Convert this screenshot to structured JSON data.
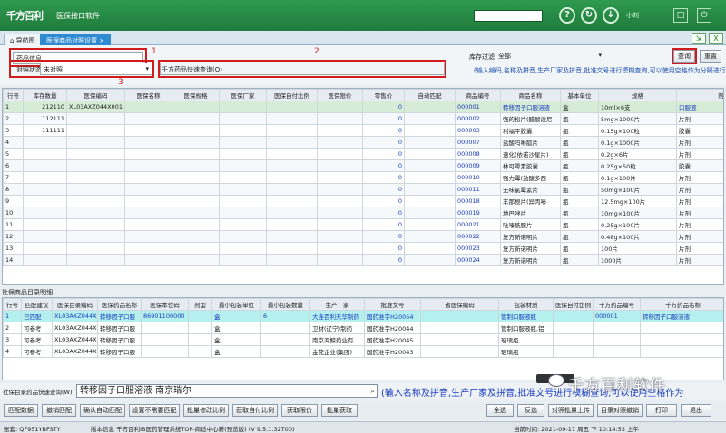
{
  "app": {
    "logo": "千方百利",
    "name": "医保接口软件",
    "user": "小刘"
  },
  "titlebar_icons": [
    "help-icon",
    "refresh-icon",
    "download-icon",
    "maximize-icon",
    "power-icon"
  ],
  "tabs": [
    {
      "label": "导航图"
    },
    {
      "label": "医保商品对照设置"
    }
  ],
  "filter": {
    "drug_input_value": "药品信息",
    "match_status_label": "对照状态",
    "match_status_value": "未对照",
    "quick_query_label": "千方药品快速查询(Q)",
    "stock_filter_label": "库存过滤",
    "stock_filter_value": "全部",
    "query_button": "查询",
    "reset_button": "重置",
    "hint": "(输入编码,名称及拼音,生产厂家及拼音,批准文号进行模糊查询,可以使用空格作为分隔进行",
    "annotations": [
      "1",
      "2",
      "3"
    ]
  },
  "upper_table": {
    "headers": [
      "行号",
      "库存数量",
      "医保编码",
      "医保名称",
      "医保规格",
      "医保厂家",
      "医保自付比例",
      "医保限价",
      "零售价",
      "自动匹配",
      "商品编号",
      "商品名称",
      "基本单位",
      "规格",
      "剂型"
    ],
    "rows": [
      [
        "1",
        "212110",
        "XL03AXZ044X001",
        "",
        "",
        "",
        "",
        "",
        "0",
        "",
        "000001",
        "转移因子口服溶液",
        "盒",
        "10ml×6支",
        "口服液"
      ],
      [
        "2",
        "112111",
        "",
        "",
        "",
        "",
        "",
        "",
        "0",
        "",
        "000002",
        "强的松片(醋酸泼尼",
        "瓶",
        "5mg×1000片",
        "片剂"
      ],
      [
        "3",
        "111111",
        "",
        "",
        "",
        "",
        "",
        "",
        "0",
        "",
        "000003",
        "利福平胶囊",
        "瓶",
        "0.15g×100粒",
        "胶囊"
      ],
      [
        "4",
        "",
        "",
        "",
        "",
        "",
        "",
        "",
        "0",
        "",
        "000007",
        "盐酸吗啉胍片",
        "瓶",
        "0.1g×1000片",
        "片剂"
      ],
      [
        "5",
        "",
        "",
        "",
        "",
        "",
        "",
        "",
        "0",
        "",
        "000008",
        "速化(依诺沙星片)",
        "瓶",
        "0.2g×6片",
        "片剂"
      ],
      [
        "6",
        "",
        "",
        "",
        "",
        "",
        "",
        "",
        "0",
        "",
        "000009",
        "林可霉素胶囊",
        "瓶",
        "0.25g×50粒",
        "胶囊"
      ],
      [
        "7",
        "",
        "",
        "",
        "",
        "",
        "",
        "",
        "0",
        "",
        "000010",
        "强力霉(盐酸多西",
        "瓶",
        "0.1g×100片",
        "片剂"
      ],
      [
        "8",
        "",
        "",
        "",
        "",
        "",
        "",
        "",
        "0",
        "",
        "000011",
        "无味氯霉素片",
        "瓶",
        "50mg×100片",
        "片剂"
      ],
      [
        "9",
        "",
        "",
        "",
        "",
        "",
        "",
        "",
        "0",
        "",
        "000018",
        "丰那根片(异丙嗪",
        "瓶",
        "12.5mg×100片",
        "片剂"
      ],
      [
        "10",
        "",
        "",
        "",
        "",
        "",
        "",
        "",
        "0",
        "",
        "000019",
        "地巴唑片",
        "瓶",
        "10mg×100片",
        "片剂"
      ],
      [
        "11",
        "",
        "",
        "",
        "",
        "",
        "",
        "",
        "0",
        "",
        "000021",
        "吡嗪酰胺片",
        "瓶",
        "0.25g×100片",
        "片剂"
      ],
      [
        "12",
        "",
        "",
        "",
        "",
        "",
        "",
        "",
        "0",
        "",
        "000022",
        "复方新诺明片",
        "瓶",
        "0.48g×100片",
        "片剂"
      ],
      [
        "13",
        "",
        "",
        "",
        "",
        "",
        "",
        "",
        "0",
        "",
        "000023",
        "复方新诺明片",
        "瓶",
        "100片",
        "片剂"
      ],
      [
        "14",
        "",
        "",
        "",
        "",
        "",
        "",
        "",
        "0",
        "",
        "000024",
        "复方新诺明片",
        "瓶",
        "1000片",
        "片剂"
      ]
    ]
  },
  "lower_section_title": "社保商品目录明细",
  "lower_table": {
    "headers": [
      "行号",
      "匹配建议",
      "医保目录编码",
      "医保药品名称",
      "医保本位码",
      "剂型",
      "最小包装单位",
      "最小包装数量",
      "生产厂家",
      "批准文号",
      "省医保编码",
      "包装材质",
      "医保自付比例",
      "千方药品编号",
      "千方药品名称"
    ],
    "rows": [
      [
        "1",
        "已匹配",
        "XL03AXZ044X00",
        "转移因子口服",
        "86901100000",
        "",
        "盒",
        "6",
        "大连百利天华制药",
        "国药准字H20054",
        "",
        "管制口服液瓶",
        "",
        "000001",
        "转移因子口服溶液"
      ],
      [
        "2",
        "可参考",
        "XL03AXZ044X00",
        "转移因子口服",
        "",
        "",
        "盒",
        "",
        "卫材(辽宁)制药",
        "国药准字H20044",
        "",
        "管制口服液瓶,铝",
        "",
        "",
        ""
      ],
      [
        "3",
        "可参考",
        "XL03AXZ044X00",
        "转移因子口服",
        "",
        "",
        "盒",
        "",
        "南京海鲸药业有",
        "国药准字H20045",
        "",
        "玻璃瓶",
        "",
        "",
        ""
      ],
      [
        "4",
        "可参考",
        "XL03AXZ044X00",
        "转移因子口服",
        "",
        "",
        "盒",
        "",
        "金花企业(集团)",
        "国药准字H20043",
        "",
        "玻璃瓶",
        "",
        "",
        ""
      ]
    ]
  },
  "quick_query": {
    "label": "社保目录药品快速查询(W)",
    "value": "转移因子口服溶液 南京瑞尔",
    "hint": "(输入名称及拼音,生产厂家及拼音,批准文号进行模糊查询,可以使用空格作为"
  },
  "left_buttons": [
    "匹配数据",
    "撤销匹配",
    "确认自动匹配",
    "设置不需要匹配",
    "批量修改比例",
    "获取自付比例",
    "获取限价",
    "批量获取"
  ],
  "right_buttons": [
    "全选",
    "反选",
    "对照批量上传",
    "目录对照撤销",
    "打印",
    "退出"
  ],
  "watermark": "千方百利软件",
  "status": {
    "account": "账套: QF951YBFSTY",
    "version_info": "版本信息  千方百利IB医药管理系统TOP-商适中心新(预览版)   (V 9.5.1.32T00)",
    "date": "当前时间: 2021-09-17 周五 下 10:14:53 上午"
  }
}
